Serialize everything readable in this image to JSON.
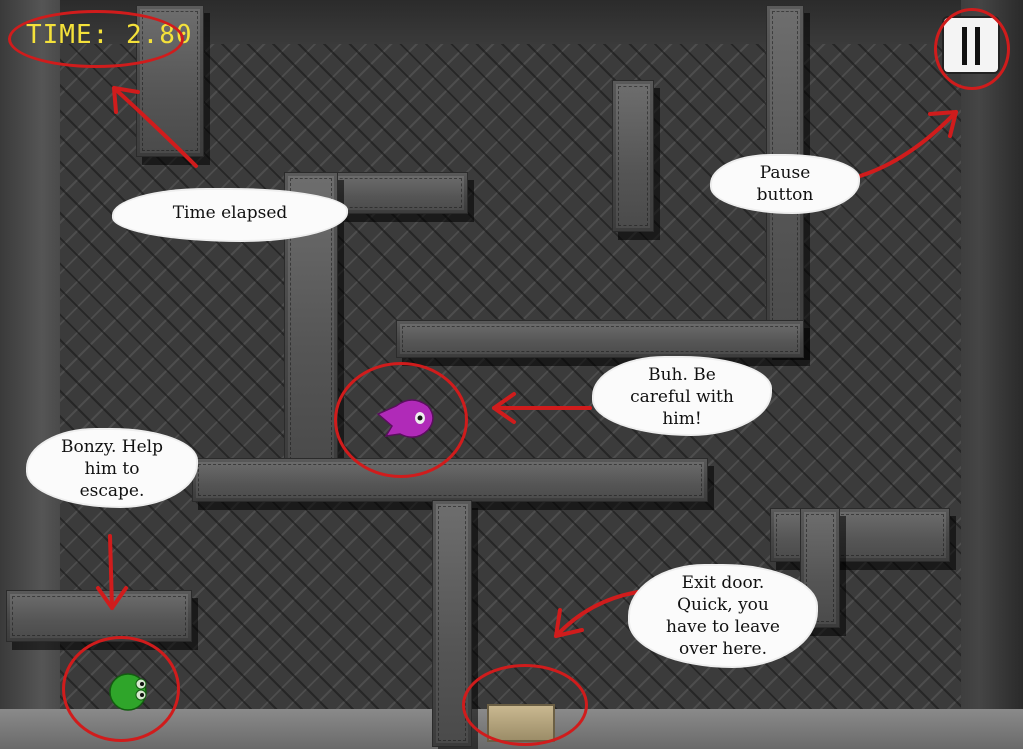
{
  "hud": {
    "time_label": "TIME:",
    "time_value": "2.80",
    "time_color": "#f5e23a"
  },
  "pause": {
    "icon": "pause-icon"
  },
  "annotations": {
    "time_elapsed": "Time elapsed",
    "pause_line1": "Pause",
    "pause_line2": "button",
    "enemy_line1": "Buh. Be",
    "enemy_line2": "careful with",
    "enemy_line3": "him!",
    "hero_line1": "Bonzy. Help",
    "hero_line2": "him to",
    "hero_line3": "escape.",
    "exit_line1": "Exit door.",
    "exit_line2": "Quick, you",
    "exit_line3": "have to leave",
    "exit_line4": "over here."
  },
  "colors": {
    "annotation_red": "#d01c1c",
    "enemy_magenta": "#b02ab8",
    "hero_green": "#2fa52a"
  }
}
